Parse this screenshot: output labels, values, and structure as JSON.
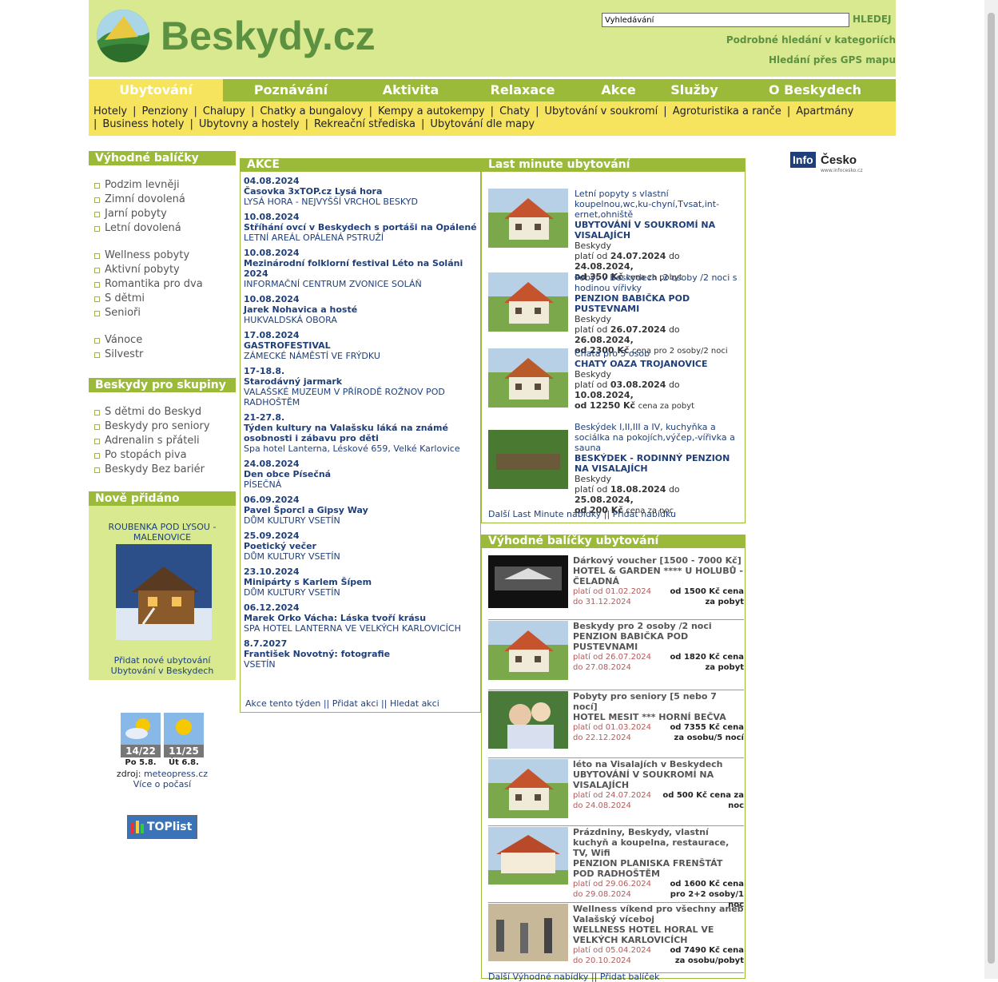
{
  "header": {
    "logo_text": "Beskydy.cz",
    "search_placeholder": "Vyhledávání",
    "search_button": "HLEDEJ",
    "link_category": "Podrobné hledání v kategoriích",
    "link_gps": "Hledání přes GPS mapu"
  },
  "nav": [
    {
      "label": "Ubytování",
      "active": true
    },
    {
      "label": "Poznávání"
    },
    {
      "label": "Aktivita"
    },
    {
      "label": "Relaxace"
    },
    {
      "label": "Akce"
    },
    {
      "label": "Služby"
    },
    {
      "label": "O Beskydech"
    }
  ],
  "subnav": [
    "Hotely",
    "Penziony",
    "Chalupy",
    "Chatky a bungalovy",
    "Kempy a autokempy",
    "Chaty",
    "Ubytování v soukromí",
    "Agroturistika a ranče",
    "Apartmány",
    "Business hotely",
    "Ubytovny a hostely",
    "Rekreační střediska",
    "Ubytování dle mapy"
  ],
  "sidebar": {
    "packages_title": "Výhodné balíčky",
    "packages_1": [
      "Podzim levněji",
      "Zimní dovolená",
      "Jarní pobyty",
      "Letní dovolená"
    ],
    "packages_2": [
      "Wellness pobyty",
      "Aktivní pobyty",
      "Romantika pro dva",
      "S dětmi",
      "Senioři"
    ],
    "packages_3": [
      "Vánoce",
      "Silvestr"
    ],
    "groups_title": "Beskydy pro skupiny",
    "groups": [
      "S dětmi do Beskyd",
      "Beskydy pro seniory",
      "Adrenalin s přáteli",
      "Po stopách piva",
      "Beskydy Bez bariér"
    ],
    "new_title": "Nově přidáno",
    "new_item": "ROUBENKA POD LYSOU - MALENOVICE",
    "new_add": "Přidat nové ubytování",
    "new_link": "Ubytování v Beskydech"
  },
  "weather": {
    "day1_temp": "14/22",
    "day1_label": "Po 5.8.",
    "day2_temp": "11/25",
    "day2_label": "Út 6.8.",
    "source_label": "zdroj:",
    "source": "meteopress.cz",
    "more": "Více o počasí",
    "toplist": "TOPlist"
  },
  "events": {
    "title": "AKCE",
    "items": [
      {
        "date": "04.08.2024",
        "title": "Časovka 3xTOP.cz Lysá hora",
        "place": "LYSÁ HORA - NEJVYŠŠÍ VRCHOL BESKYD"
      },
      {
        "date": "10.08.2024",
        "title": "Stříhání ovcí v Beskydech s portáši na Opálené",
        "place": "LETNÍ AREÁL OPÁLENÁ PSTRUŽÍ"
      },
      {
        "date": "10.08.2024",
        "title": "Mezinárodní folklorní festival Léto na Soláni 2024",
        "place": "INFORMAČNÍ CENTRUM ZVONICE SOLÁŇ"
      },
      {
        "date": "10.08.2024",
        "title": "Jarek Nohavica a hosté",
        "place": "HUKVALDSKÁ OBORA"
      },
      {
        "date": "17.08.2024",
        "title": "GASTROFESTIVAL",
        "place": "ZÁMECKÉ NÁMĚSTÍ VE FRÝDKU"
      },
      {
        "date": "17-18.8.",
        "title": "Starodávný jarmark",
        "place": "VALAŠSKÉ MUZEUM V PŘÍRODĚ ROŽNOV POD RADHOŠTĚM"
      },
      {
        "date": "21-27.8.",
        "title": "Týden kultury na Valašsku láká na známé osobnosti i zábavu pro děti",
        "place": "Spa hotel Lanterna, Léskové 659, Velké Karlovice"
      },
      {
        "date": "24.08.2024",
        "title": "Den obce Písečná",
        "place": "PÍSEČNÁ"
      },
      {
        "date": "06.09.2024",
        "title": "Pavel Šporcl a Gipsy Way",
        "place": "DŮM KULTURY VSETÍN"
      },
      {
        "date": "25.09.2024",
        "title": "Poetický večer",
        "place": "DŮM KULTURY VSETÍN"
      },
      {
        "date": "23.10.2024",
        "title": "Minipárty s Karlem Šípem",
        "place": "DŮM KULTURY VSETÍN"
      },
      {
        "date": "06.12.2024",
        "title": "Marek Orko Vácha: Láska tvoří krásu",
        "place": "SPA HOTEL LANTERNA VE VELKÝCH KARLOVICÍCH"
      },
      {
        "date": "8.7.2027",
        "title": "František Novotný: fotografie",
        "place": "VSETÍN"
      }
    ],
    "footer": [
      "Akce tento týden",
      "Přidat akci",
      "Hledat akci"
    ]
  },
  "lastminute": {
    "title": "Last minute ubytování",
    "items": [
      {
        "desc": "Letní popyty s vlastní koupelnou,wc,ku-chyní,Tvsat,int-ernet,ohniště",
        "name": "UBYTOVÁNÍ V SOUKROMÍ NA VISALAJÍCH",
        "region": "Beskydy",
        "valid": "platí od",
        "from": "24.07.2024",
        "to_label": "do",
        "to": "24.08.2024,",
        "price_label": "od",
        "price": "350 Kč",
        "unit": "cena za pobyt"
      },
      {
        "desc": "Pobyt v Beskydech ,2 osoby /2 noci s hodinou vířivky",
        "name": "PENZION BABIČKA POD PUSTEVNAMI",
        "region": "Beskydy",
        "valid": "platí od",
        "from": "26.07.2024",
        "to_label": "do",
        "to": "26.08.2024,",
        "price_label": "od",
        "price": "2300 Kč",
        "unit": "cena pro 2 osoby/2 noci"
      },
      {
        "desc": "Chata pro 5 osob",
        "name": "CHATY OAZA TROJANOVICE",
        "region": "Beskydy",
        "valid": "platí od",
        "from": "03.08.2024",
        "to_label": "do",
        "to": "10.08.2024,",
        "price_label": "od",
        "price": "12250 Kč",
        "unit": "cena za pobyt"
      },
      {
        "desc": "Beskýdek I,II,III a IV, kuchyňka a sociálka na pokojích,výčep,-vířivka a sauna",
        "name": "BESKÝDEK - RODINNÝ PENZION NA VISALAJÍCH",
        "region": "Beskydy",
        "valid": "platí od",
        "from": "18.08.2024",
        "to_label": "do",
        "to": "25.08.2024,",
        "price_label": "od",
        "price": "200 Kč",
        "unit": "cena za noc"
      }
    ],
    "footer": [
      "Další Last Minute nabídky",
      "Přidat nabídku"
    ]
  },
  "packages": {
    "title": "Výhodné balíčky ubytování",
    "items": [
      {
        "title": "Dárkový voucher [1500 - 7000 Kč]",
        "name": "HOTEL & GARDEN **** U HOLUBŮ - ČELADNÁ",
        "valid": "platí od 01.02.2024 do 31.12.2024",
        "price": "od 1500 Kč cena za pobyt"
      },
      {
        "title": "Beskydy pro 2 osoby /2 noci",
        "name": "PENZION BABIČKA POD PUSTEVNAMI",
        "valid": "platí od 26.07.2024 do 27.08.2024",
        "price": "od 1820 Kč cena za pobyt"
      },
      {
        "title": "Pobyty pro seniory [5 nebo 7 nocí]",
        "name": "HOTEL MESIT *** HORNÍ BEČVA",
        "valid": "platí od 01.03.2024 do 22.12.2024",
        "price": "od 7355 Kč cena za osobu/5 nocí"
      },
      {
        "title": "léto na Visalajích v Beskydech",
        "name": "UBYTOVÁNÍ V SOUKROMÍ NA VISALAJÍCH",
        "valid": "platí od 24.07.2024 do 24.08.2024",
        "price": "od 500 Kč cena za noc"
      },
      {
        "title": "Prázdniny, Beskydy, vlastní kuchyň a koupelna, restaurace, TV, Wifi",
        "name": "PENZION PLANISKA FRENŠTÁT POD RADHOŠTĚM",
        "valid": "platí od 29.06.2024 do 29.08.2024",
        "price": "od 1600 Kč cena pro 2+2 osoby/1 noc"
      },
      {
        "title": "Wellness víkend pro všechny aneb Valašský víceboj",
        "name": "WELLNESS HOTEL HORAL VE VELKÝCH KARLOVICÍCH",
        "valid": "platí od 05.04.2024 do 20.10.2024",
        "price": "od 7490 Kč cena za osobu/pobyt"
      }
    ],
    "footer": [
      "Další Výhodné nabídky",
      "Přidat balíček"
    ]
  },
  "banner": {
    "info": "Info",
    "cesko": "Česko",
    "url": "www.infocesko.cz"
  }
}
